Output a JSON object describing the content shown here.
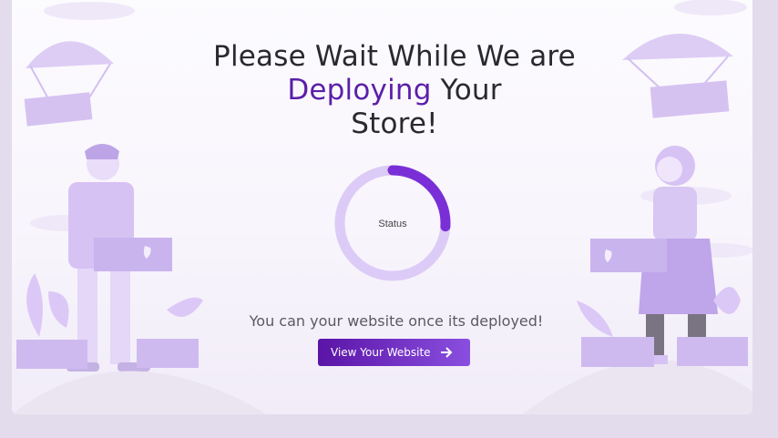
{
  "heading": {
    "line1": "Please Wait While We are",
    "accent": "Deploying",
    "line2_rest": " Your",
    "line3": "Store!"
  },
  "status": {
    "label": "Status",
    "progress": 0.26,
    "track_color": "#dccbf7",
    "fill_color": "#7a2fd6"
  },
  "message": "You can your website once its deployed!",
  "cta": {
    "label": "View Your Website",
    "icon": "arrow-right-icon"
  },
  "colors": {
    "accent": "#5b1fa8",
    "button_start": "#5a14a6",
    "button_end": "#8a4fe0",
    "illustration": "#c9b0ec"
  }
}
